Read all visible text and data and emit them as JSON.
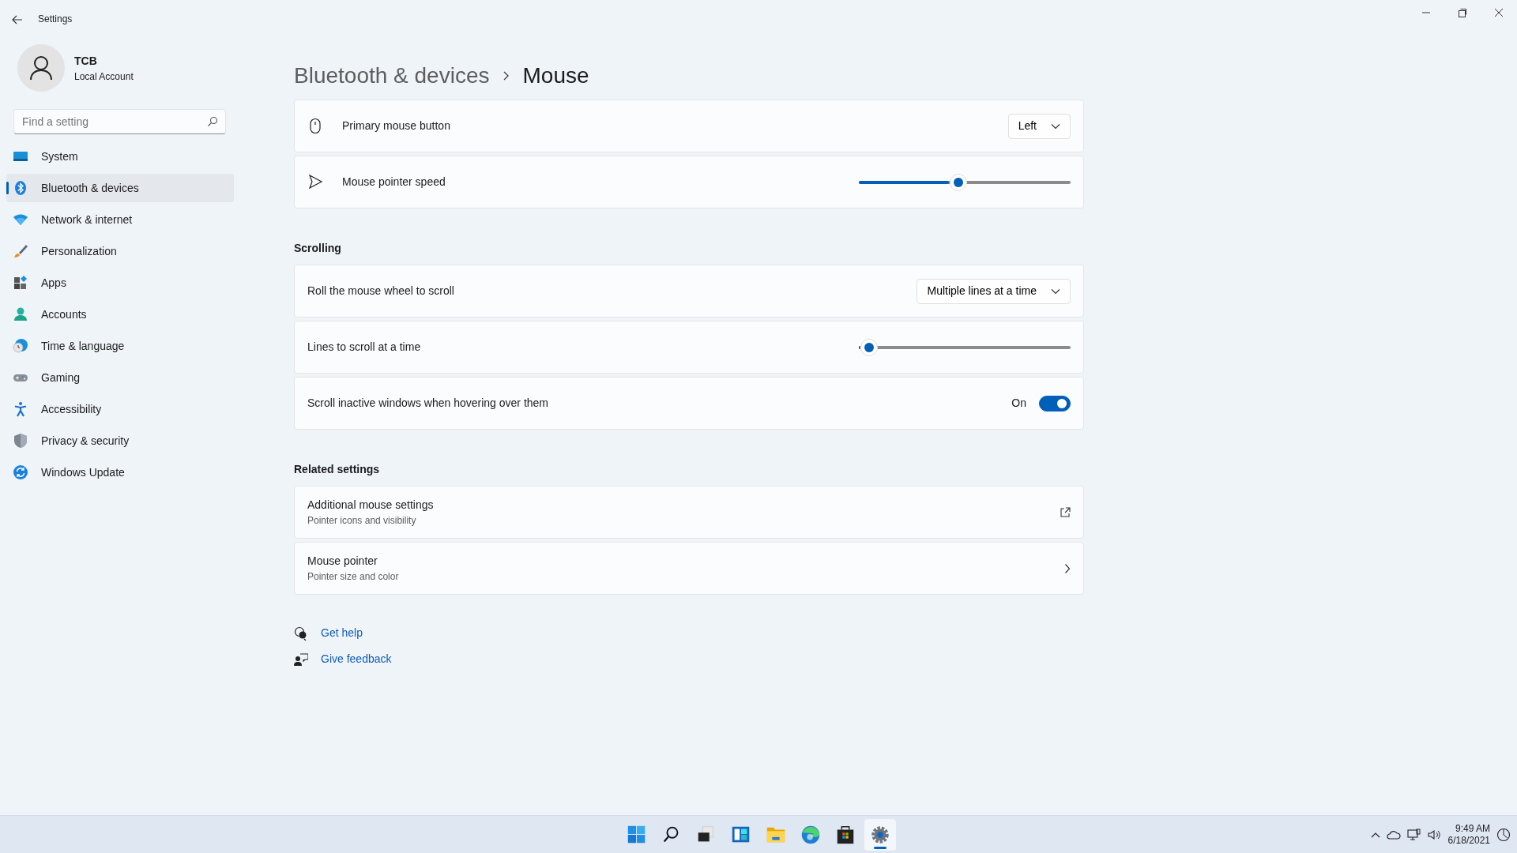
{
  "window": {
    "title": "Settings"
  },
  "account": {
    "name": "TCB",
    "type": "Local Account"
  },
  "search": {
    "placeholder": "Find a setting"
  },
  "nav": [
    {
      "label": "System",
      "kind": "system",
      "selected": false
    },
    {
      "label": "Bluetooth & devices",
      "kind": "bluetooth",
      "selected": true
    },
    {
      "label": "Network & internet",
      "kind": "network",
      "selected": false
    },
    {
      "label": "Personalization",
      "kind": "brush",
      "selected": false
    },
    {
      "label": "Apps",
      "kind": "apps",
      "selected": false
    },
    {
      "label": "Accounts",
      "kind": "accounts",
      "selected": false
    },
    {
      "label": "Time & language",
      "kind": "time",
      "selected": false
    },
    {
      "label": "Gaming",
      "kind": "gaming",
      "selected": false
    },
    {
      "label": "Accessibility",
      "kind": "accessibility",
      "selected": false
    },
    {
      "label": "Privacy & security",
      "kind": "privacy",
      "selected": false
    },
    {
      "label": "Windows Update",
      "kind": "update",
      "selected": false
    }
  ],
  "breadcrumb": [
    "Bluetooth & devices",
    "Mouse"
  ],
  "sections": [
    {
      "rows": [
        {
          "kind": "dropdown",
          "label": "Primary mouse button",
          "value": "Left"
        },
        {
          "kind": "slider",
          "label": "Mouse pointer speed",
          "level": 0.47
        }
      ]
    },
    {
      "title": "Scrolling",
      "rows": [
        {
          "kind": "dropdown",
          "label": "Roll the mouse wheel to scroll",
          "value": "Multiple lines at a time"
        },
        {
          "kind": "slider",
          "label": "Lines to scroll at a time",
          "level": 0.05
        },
        {
          "kind": "toggle",
          "label": "Scroll inactive windows when hovering over them",
          "state": "On",
          "on": true
        }
      ]
    },
    {
      "title": "Related settings",
      "rows": [
        {
          "kind": "external",
          "label": "Additional mouse settings",
          "description": "Pointer icons and visibility"
        },
        {
          "kind": "nav",
          "label": "Mouse pointer",
          "description": "Pointer size and color"
        }
      ]
    }
  ],
  "help_links": [
    {
      "kind": "help",
      "label": "Get help"
    },
    {
      "kind": "feedback",
      "label": "Give feedback"
    }
  ],
  "taskbar": {
    "apps": [
      {
        "kind": "start",
        "selected": false
      },
      {
        "kind": "search",
        "selected": false
      },
      {
        "kind": "taskview",
        "selected": false
      },
      {
        "kind": "widgets",
        "selected": false
      },
      {
        "kind": "explorer",
        "selected": false
      },
      {
        "kind": "edge",
        "selected": false
      },
      {
        "kind": "store",
        "selected": false
      },
      {
        "kind": "settings",
        "selected": true
      }
    ],
    "time": "9:49 AM",
    "date": "6/18/2021"
  }
}
